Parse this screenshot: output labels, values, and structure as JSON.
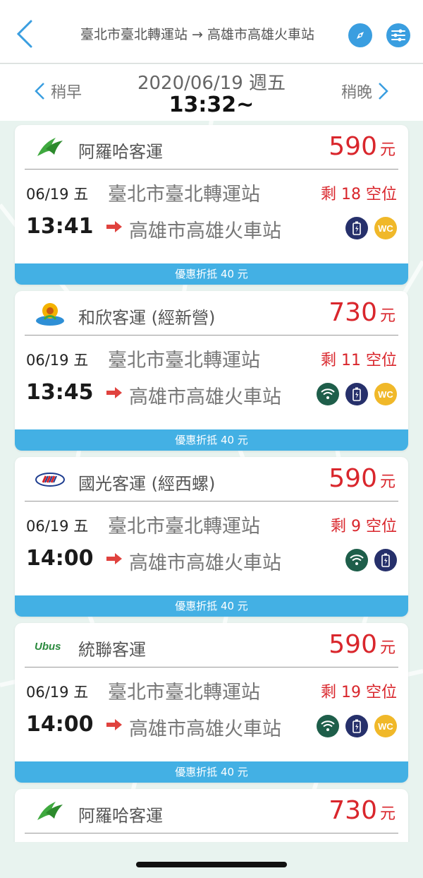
{
  "header": {
    "route_title": "臺北市臺北轉運站 → 高雄市高雄火車站",
    "accent_color": "#3a9ee0"
  },
  "date_nav": {
    "earlier_label": "稍早",
    "later_label": "稍晚",
    "date": "2020/06/19 週五",
    "time": "13:32~"
  },
  "trips": [
    {
      "company": "阿羅哈客運",
      "logo": "aloha-logo",
      "price": "590",
      "currency": "元",
      "date": "06/19 五",
      "time": "13:41",
      "from": "臺北市臺北轉運站",
      "to": "高雄市高雄火車站",
      "seats": "剩 18 空位",
      "amenities": [
        "battery-icon",
        "wc-icon"
      ],
      "discount": "優惠折抵 40 元"
    },
    {
      "company": "和欣客運 (經新營)",
      "logo": "hoshin-logo",
      "price": "730",
      "currency": "元",
      "date": "06/19 五",
      "time": "13:45",
      "from": "臺北市臺北轉運站",
      "to": "高雄市高雄火車站",
      "seats": "剩 11 空位",
      "amenities": [
        "wifi-icon",
        "battery-icon",
        "wc-icon"
      ],
      "discount": "優惠折抵 40 元"
    },
    {
      "company": "國光客運 (經西螺)",
      "logo": "kuo-kuang-logo",
      "price": "590",
      "currency": "元",
      "date": "06/19 五",
      "time": "14:00",
      "from": "臺北市臺北轉運站",
      "to": "高雄市高雄火車站",
      "seats": "剩 9 空位",
      "amenities": [
        "wifi-icon",
        "battery-icon"
      ],
      "discount": "優惠折抵 40 元"
    },
    {
      "company": "統聯客運",
      "logo": "ubus-logo",
      "price": "590",
      "currency": "元",
      "date": "06/19 五",
      "time": "14:00",
      "from": "臺北市臺北轉運站",
      "to": "高雄市高雄火車站",
      "seats": "剩 19 空位",
      "amenities": [
        "wifi-icon",
        "battery-icon",
        "wc-icon"
      ],
      "discount": "優惠折抵 40 元"
    },
    {
      "company": "阿羅哈客運",
      "logo": "aloha-logo",
      "price": "730",
      "currency": "元"
    }
  ],
  "wc_label": "WC",
  "ubus_wordmark": "Ubus",
  "colors": {
    "price_red": "#d9262c",
    "discount_blue": "#43b0e4",
    "wifi_green": "#1e5e4a",
    "battery_navy": "#26306b",
    "wc_yellow": "#f0b829"
  }
}
